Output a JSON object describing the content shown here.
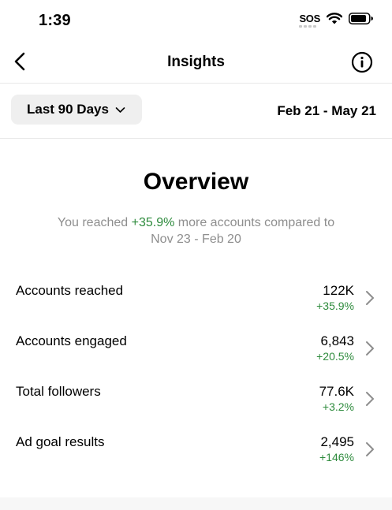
{
  "status_bar": {
    "time": "1:39",
    "sos": "SOS"
  },
  "nav": {
    "title": "Insights"
  },
  "filter": {
    "range_label": "Last 90 Days",
    "date_range": "Feb 21 - May 21"
  },
  "overview": {
    "title": "Overview",
    "summary_prefix": "You reached ",
    "summary_highlight": "+35.9%",
    "summary_suffix": " more accounts compared to",
    "summary_line2": "Nov 23 - Feb 20"
  },
  "metrics": [
    {
      "label": "Accounts reached",
      "value": "122K",
      "change": "+35.9%"
    },
    {
      "label": "Accounts engaged",
      "value": "6,843",
      "change": "+20.5%"
    },
    {
      "label": "Total followers",
      "value": "77.6K",
      "change": "+3.2%"
    },
    {
      "label": "Ad goal results",
      "value": "2,495",
      "change": "+146%"
    }
  ],
  "colors": {
    "positive": "#2e8b3d",
    "muted": "#8e8e8e",
    "chip_bg": "#efefef"
  },
  "icons": [
    "back-chevron-icon",
    "info-icon",
    "chevron-down-icon",
    "chevron-right-icon",
    "wifi-icon",
    "battery-icon"
  ]
}
